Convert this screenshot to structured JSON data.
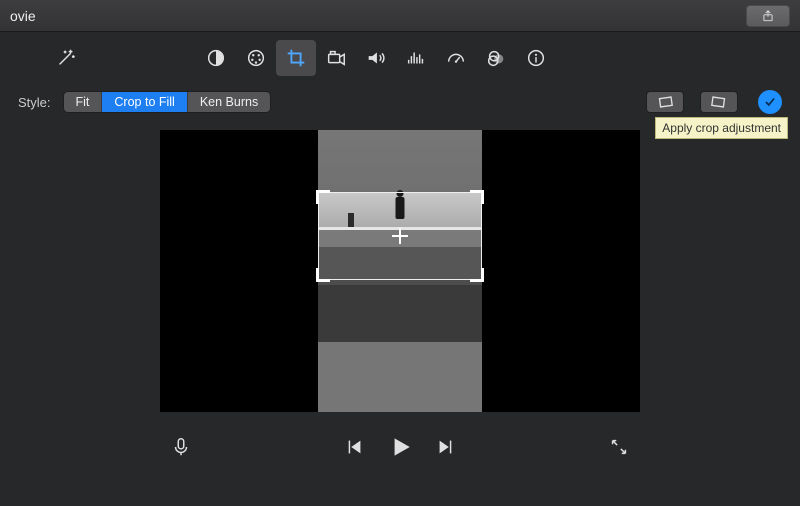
{
  "titlebar": {
    "title_fragment": "ovie"
  },
  "icons": {
    "share": "share-icon",
    "wand": "magic-wand-icon",
    "color_balance": "color-balance-icon",
    "color_correct": "color-palette-icon",
    "crop": "crop-icon",
    "stabilize": "camera-icon",
    "volume": "speaker-icon",
    "eq": "equalizer-icon",
    "speed": "speedometer-icon",
    "filters": "overlap-circles-icon",
    "info": "info-icon",
    "rotate_ccw": "rotate-ccw-icon",
    "rotate_cw": "rotate-cw-icon",
    "check": "checkmark-icon",
    "mic": "microphone-icon",
    "prev": "skip-back-icon",
    "play": "play-icon",
    "next": "skip-forward-icon",
    "fullscreen": "expand-arrows-icon"
  },
  "style": {
    "label": "Style:",
    "options": [
      "Fit",
      "Crop to Fill",
      "Ken Burns"
    ],
    "selected_index": 1
  },
  "apply": {
    "tooltip": "Apply crop adjustment"
  },
  "colors": {
    "accent": "#1e7ff2",
    "apply": "#1e90ff"
  }
}
